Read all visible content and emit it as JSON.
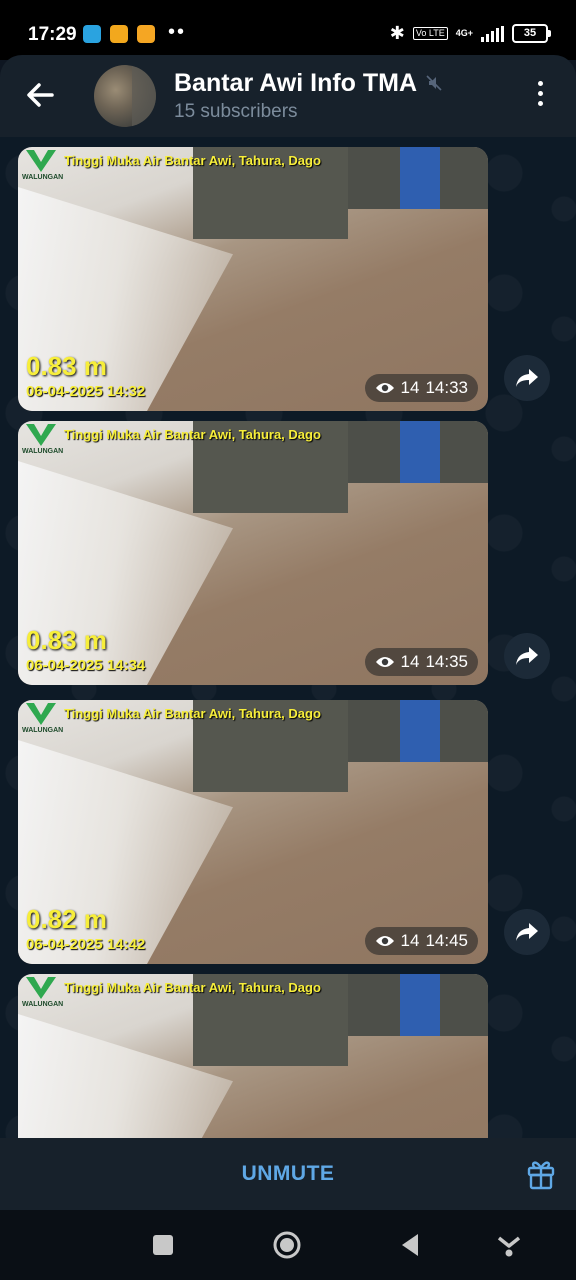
{
  "status_bar": {
    "time": "17:29",
    "dots": "••",
    "network": "4G+",
    "volte": "Vo LTE",
    "battery": "35",
    "icons": [
      "telegram-icon",
      "app-icon",
      "notes-icon",
      "bluetooth-icon",
      "signal-icon",
      "battery-icon"
    ]
  },
  "header": {
    "title": "Bantar Awi Info TMA",
    "subtitle": "15 subscribers"
  },
  "messages": [
    {
      "caption": "Tinggi Muka Air Bantar Awi, Tahura, Dago",
      "logo_text": "WALUNGAN",
      "level": "0.83 m",
      "date": "06-04-2025 14:32",
      "views": "14",
      "time": "14:33"
    },
    {
      "caption": "Tinggi Muka Air Bantar Awi, Tahura, Dago",
      "logo_text": "WALUNGAN",
      "level": "0.83 m",
      "date": "06-04-2025 14:34",
      "views": "14",
      "time": "14:35"
    },
    {
      "caption": "Tinggi Muka Air Bantar Awi, Tahura, Dago",
      "logo_text": "WALUNGAN",
      "level": "0.82 m",
      "date": "06-04-2025 14:42",
      "views": "14",
      "time": "14:45"
    },
    {
      "caption": "Tinggi Muka Air Bantar Awi, Tahura, Dago",
      "logo_text": "WALUNGAN"
    }
  ],
  "bottom": {
    "unmute_label": "UNMUTE"
  },
  "colors": {
    "accent": "#5fa8e6",
    "header_bg": "#17212b",
    "chat_bg": "#0d1a26",
    "overlay_text": "#f7ee3a"
  }
}
